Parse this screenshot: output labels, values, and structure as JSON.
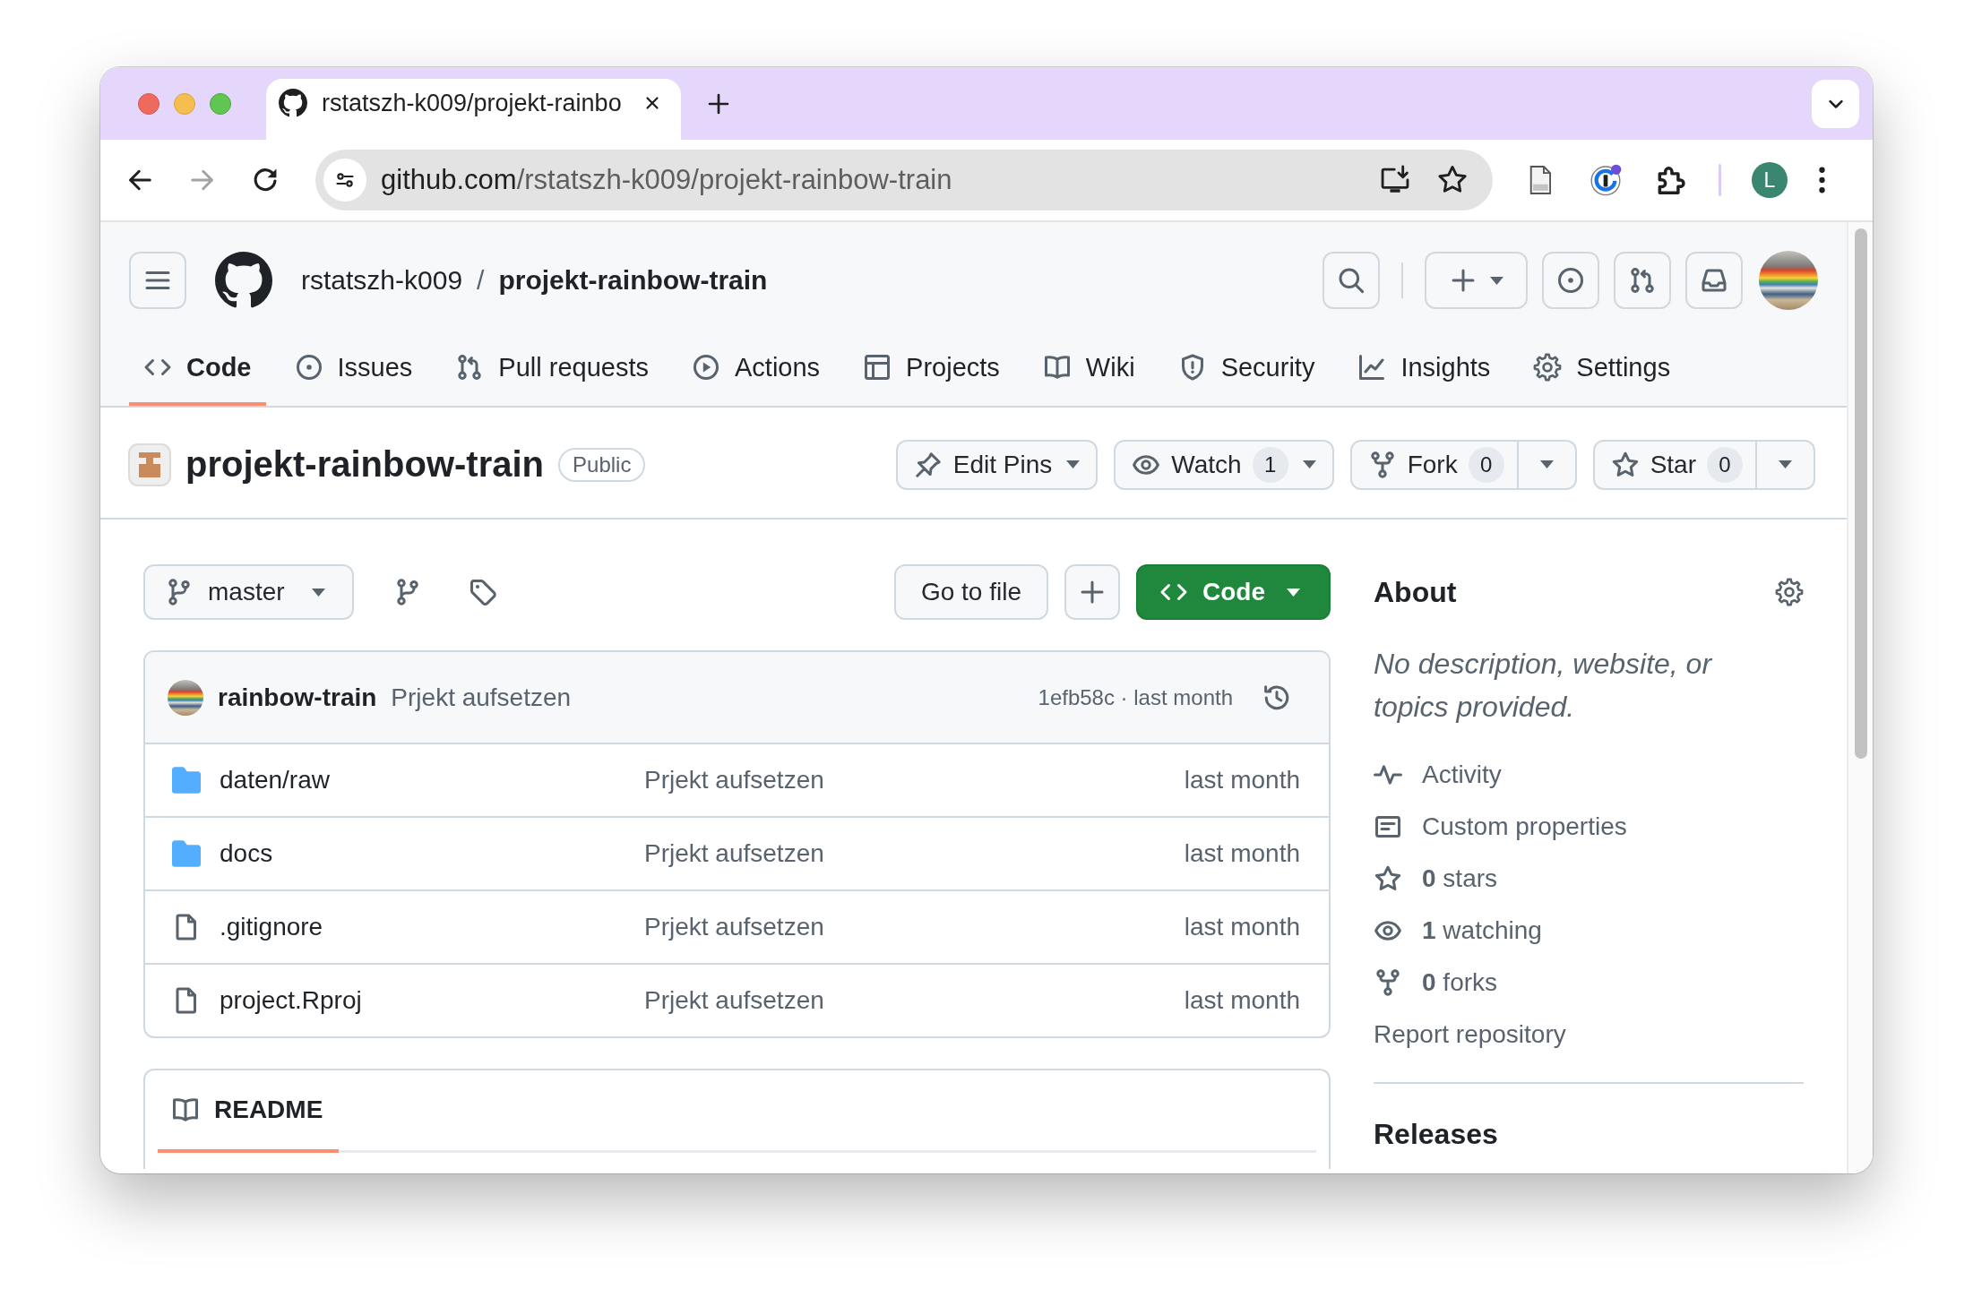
{
  "browser": {
    "tabs": [
      {
        "title": "rstatszh-k009/projekt-rainbo",
        "selected": true
      }
    ],
    "address": {
      "host": "github.com",
      "path": "/rstatszh-k009/projekt-rainbow-train"
    },
    "profile_initial": "L"
  },
  "header": {
    "owner": "rstatszh-k009",
    "separator": "/",
    "repo": "projekt-rainbow-train"
  },
  "repo_nav": [
    {
      "label": "Code",
      "selected": true
    },
    {
      "label": "Issues",
      "selected": false
    },
    {
      "label": "Pull requests",
      "selected": false
    },
    {
      "label": "Actions",
      "selected": false
    },
    {
      "label": "Projects",
      "selected": false
    },
    {
      "label": "Wiki",
      "selected": false
    },
    {
      "label": "Security",
      "selected": false
    },
    {
      "label": "Insights",
      "selected": false
    },
    {
      "label": "Settings",
      "selected": false
    }
  ],
  "repo_header": {
    "name": "projekt-rainbow-train",
    "visibility": "Public",
    "actions": [
      {
        "kind": "menu",
        "label": "Edit Pins"
      },
      {
        "kind": "counter",
        "label": "Watch",
        "count": "1"
      },
      {
        "kind": "split",
        "label": "Fork",
        "count": "0"
      },
      {
        "kind": "split",
        "label": "Star",
        "count": "0"
      }
    ]
  },
  "file_browser": {
    "branch": "master",
    "go_to_file": "Go to file",
    "code_button": "Code",
    "latest_commit": {
      "author": "rainbow-train",
      "message": "Prjekt aufsetzen",
      "meta": "1efb58c · last month"
    },
    "files": [
      {
        "kind": "folder",
        "name": "daten/raw",
        "message": "Prjekt aufsetzen",
        "date": "last month"
      },
      {
        "kind": "folder",
        "name": "docs",
        "message": "Prjekt aufsetzen",
        "date": "last month"
      },
      {
        "kind": "file",
        "name": ".gitignore",
        "message": "Prjekt aufsetzen",
        "date": "last month"
      },
      {
        "kind": "file",
        "name": "project.Rproj",
        "message": "Prjekt aufsetzen",
        "date": "last month"
      }
    ]
  },
  "readme": {
    "title": "README",
    "selected": true
  },
  "about": {
    "title": "About",
    "description": "No description, website, or topics provided.",
    "links": [
      {
        "label": "Activity"
      },
      {
        "label": "Custom properties"
      },
      {
        "label": "**0** stars"
      },
      {
        "label": "**1** watching"
      },
      {
        "label": "**0** forks"
      }
    ],
    "report": "Report repository"
  },
  "releases": {
    "title": "Releases"
  }
}
